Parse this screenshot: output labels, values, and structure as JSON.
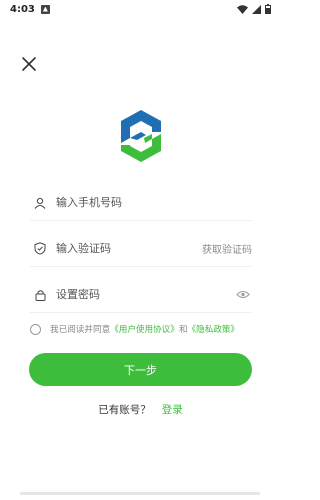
{
  "status_bar": {
    "time": "4:03"
  },
  "brand": {
    "green": "#3dbd3b",
    "blue": "#1f6fb2"
  },
  "phone_field": {
    "placeholder": "输入手机号码",
    "icon": "user-icon"
  },
  "code_field": {
    "placeholder": "输入验证码",
    "icon": "shield-icon",
    "get_code_label": "获取验证码"
  },
  "password_field": {
    "placeholder": "设置密码",
    "icon": "lock-icon",
    "toggle_icon": "eye-icon"
  },
  "agreement": {
    "prefix": "我已阅读并同意",
    "user_agreement": "《用户使用协议》",
    "and": "和",
    "privacy_policy": "《隐私政策》"
  },
  "next_button": {
    "label": "下一步"
  },
  "login_prompt": {
    "question": "已有账号？",
    "link": "登录"
  }
}
